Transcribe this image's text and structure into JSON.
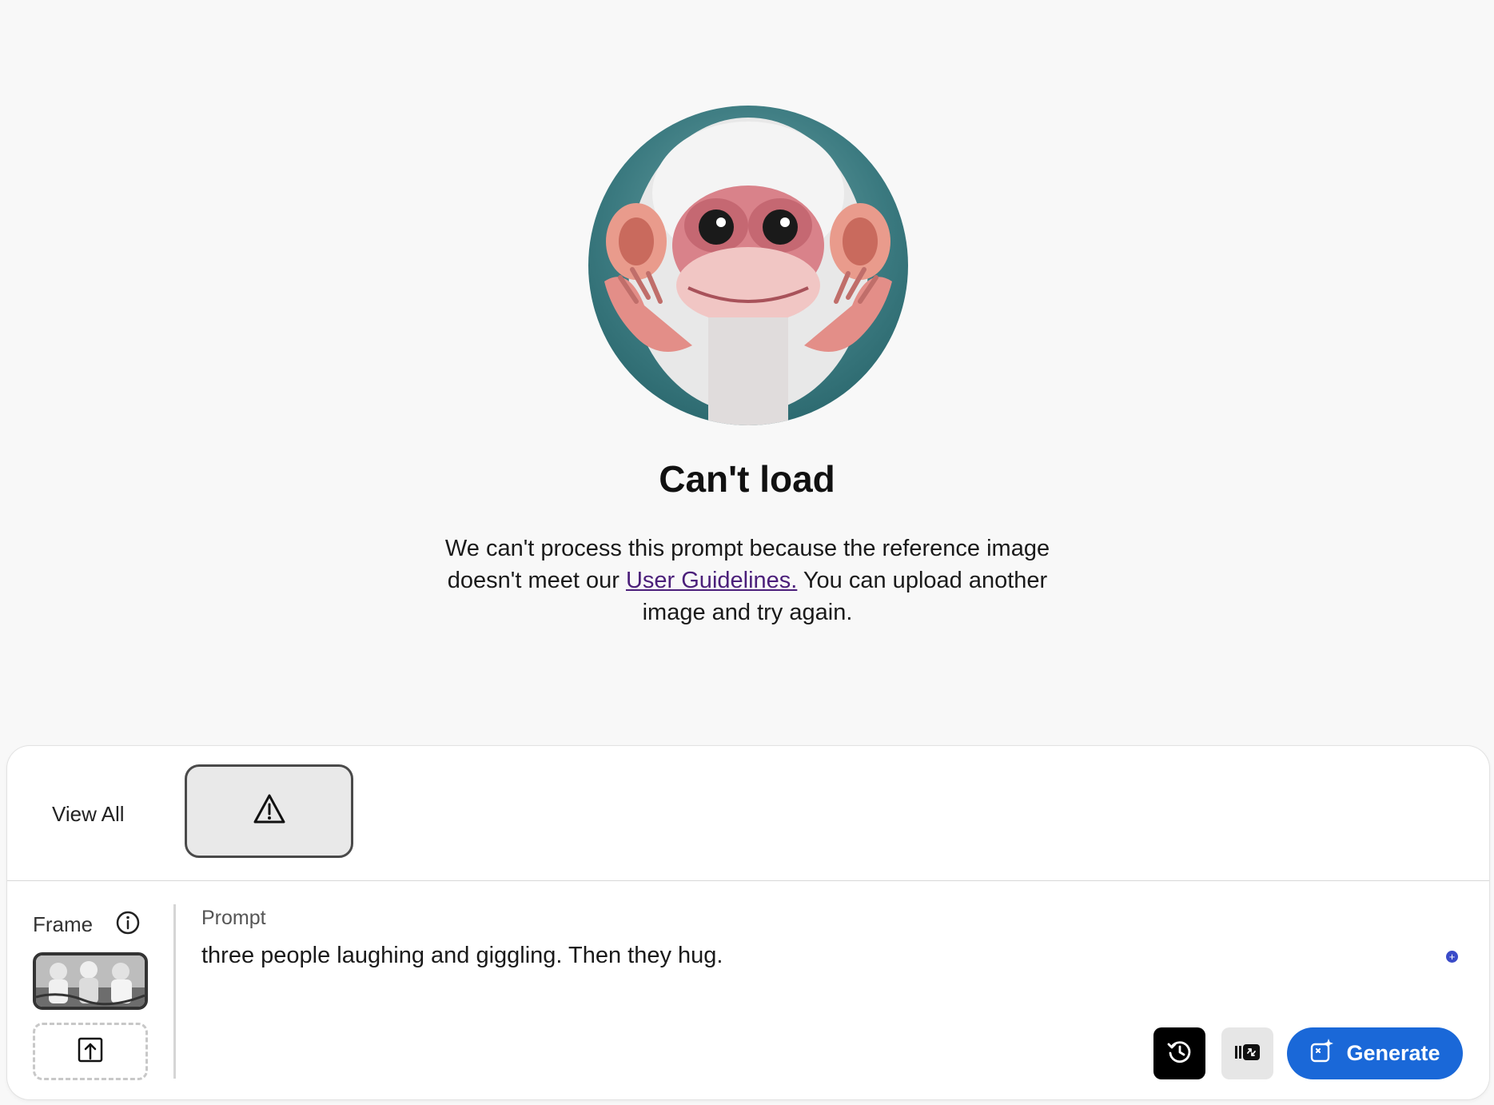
{
  "error": {
    "title": "Can't load",
    "message_before": "We can't process this prompt because the reference image doesn't meet our ",
    "link_text": "User Guidelines.",
    "message_after": " You can upload another image and try again."
  },
  "gallery": {
    "view_all_label": "View All"
  },
  "frame": {
    "label": "Frame"
  },
  "prompt": {
    "label": "Prompt",
    "value": "three people laughing and giggling. Then they hug."
  },
  "actions": {
    "generate_label": "Generate"
  },
  "colors": {
    "accent": "#1a68d8",
    "link": "#4b1f7a",
    "background": "#f8f8f8"
  },
  "icons": {
    "thumb_error": "warning-triangle-icon",
    "info": "info-icon",
    "upload": "upload-icon",
    "history": "history-icon",
    "settings": "video-settings-icon",
    "generate": "sparkle-generate-icon"
  }
}
